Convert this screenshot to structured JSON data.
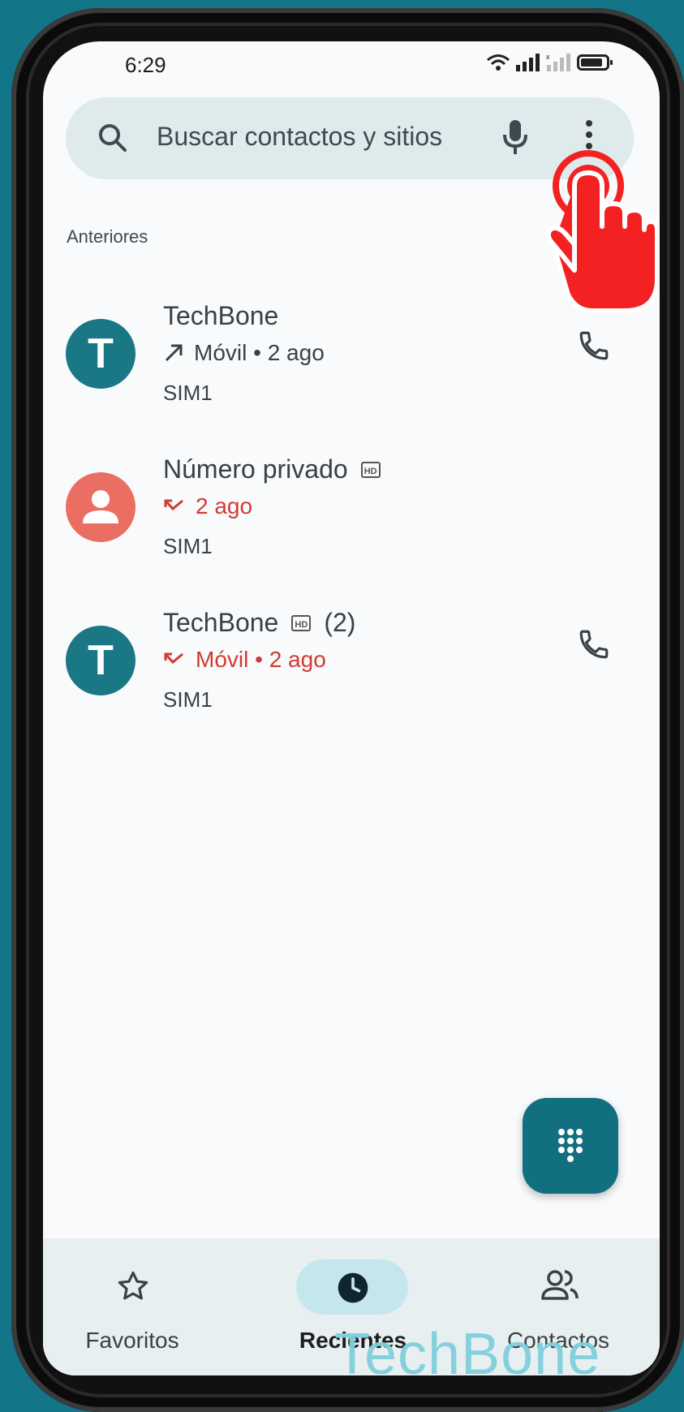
{
  "status_bar": {
    "time": "6:29"
  },
  "search": {
    "placeholder": "Buscar contactos y sitios"
  },
  "section": {
    "header": "Anteriores"
  },
  "calls": [
    {
      "initial": "T",
      "name": "TechBone",
      "badge": "",
      "count": "",
      "detail": "Móvil • 2 ago",
      "direction": "outgoing",
      "sim": "SIM1",
      "has_call_button": true
    },
    {
      "initial": "",
      "name": "Número privado",
      "badge": "HD",
      "count": "",
      "detail": "2 ago",
      "direction": "missed",
      "sim": "SIM1",
      "has_call_button": false
    },
    {
      "initial": "T",
      "name": "TechBone",
      "badge": "HD",
      "count": "(2)",
      "detail": "Móvil • 2 ago",
      "direction": "missed",
      "sim": "SIM1",
      "has_call_button": true
    }
  ],
  "nav": {
    "favorites": "Favoritos",
    "recents": "Recientes",
    "contacts": "Contactos"
  },
  "watermark": "TechBone",
  "colors": {
    "background": "#137688",
    "avatar_teal": "#1a7886",
    "avatar_coral": "#eb6e62",
    "missed_red": "#d23b31",
    "fab": "#116f7f",
    "active_pill": "#c6e6ee"
  }
}
